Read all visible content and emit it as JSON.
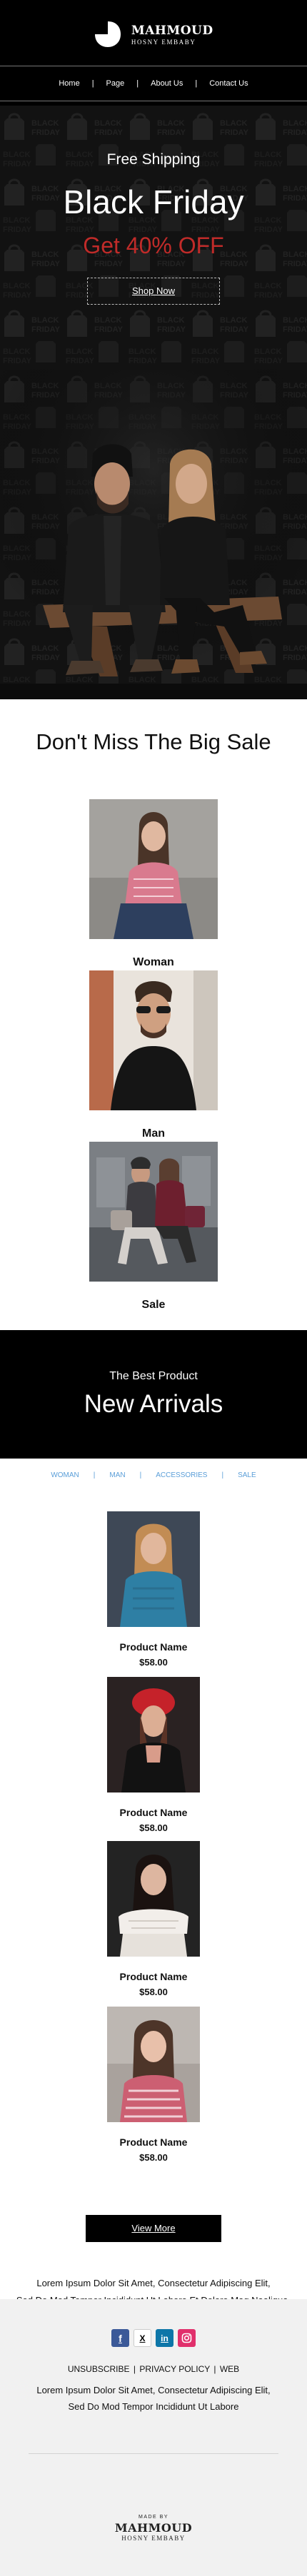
{
  "brand": {
    "name": "MAHMOUD",
    "tagline": "HOSNY EMBABY"
  },
  "nav": {
    "items": [
      "Home",
      "Page",
      "About Us",
      "Contact Us"
    ],
    "separator": "|"
  },
  "hero": {
    "pre_title": "Free Shipping",
    "title": "Black Friday",
    "offer": "Get 40% OFF",
    "button": "Shop Now",
    "pattern_text": "BLACK FRIDAY"
  },
  "sale": {
    "title": "Don't Miss The Big Sale",
    "categories": [
      {
        "label": "Woman"
      },
      {
        "label": "Man"
      },
      {
        "label": "Sale"
      }
    ]
  },
  "arrivals": {
    "pre_title": "The Best Product",
    "title": "New Arrivals",
    "tabs": [
      "WOMAN",
      "MAN",
      "ACCESSORIES",
      "SALE"
    ],
    "tab_separator": "|",
    "products": [
      {
        "name": "Product Name",
        "price": "$58.00"
      },
      {
        "name": "Product Name",
        "price": "$58.00"
      },
      {
        "name": "Product Name",
        "price": "$58.00"
      },
      {
        "name": "Product Name",
        "price": "$58.00"
      }
    ],
    "view_more": "View More",
    "lorem_line1": "Lorem Ipsum Dolor Sit Amet, Consectetur Adipiscing Elit,",
    "lorem_line2": "Sed Do Mod Tempor Incididunt Ut Labore Et Dolore Mag Naaliqua."
  },
  "footer": {
    "socials": [
      "facebook-icon",
      "x-icon",
      "linkedin-icon",
      "instagram-icon"
    ],
    "links": [
      "UNSUBSCRIBE",
      "PRIVACY POLICY",
      "WEB"
    ],
    "link_separator": "|",
    "lorem_line1": "Lorem Ipsum Dolor Sit Amet, Consectetur Adipiscing Elit,",
    "lorem_line2": "Sed Do Mod Tempor Incididunt Ut Labore",
    "made_by": "MADE BY"
  },
  "colors": {
    "accent_red": "#c02b29",
    "tab_blue": "#5a9ed8",
    "facebook": "#3b5998",
    "linkedin": "#0e76a8",
    "instagram": "#e1306c"
  }
}
